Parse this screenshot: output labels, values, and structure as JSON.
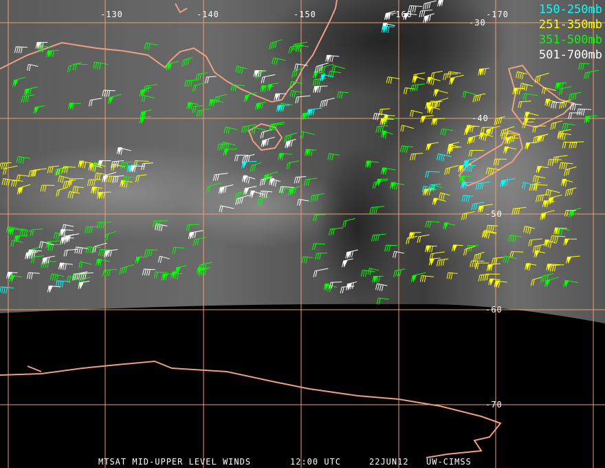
{
  "legend": [
    {
      "label": "150-250mb",
      "color": "#00ffff"
    },
    {
      "label": "251-350mb",
      "color": "#ffff00"
    },
    {
      "label": "351-500mb",
      "color": "#00ff00"
    },
    {
      "label": "501-700mb",
      "color": "#ffffff"
    }
  ],
  "longitude_labels": [
    "-130",
    "-140",
    "-150",
    "-160",
    "-170"
  ],
  "latitude_labels": [
    "-30",
    "-40",
    "-50",
    "-60",
    "-70"
  ],
  "caption": {
    "product": "MTSAT MID-UPPER LEVEL WINDS",
    "time": "12:00 UTC",
    "date": "22JUN12",
    "source": "UW-CIMSS"
  },
  "colors": {
    "grid": "#f0a070",
    "coast": "#f0a080"
  }
}
